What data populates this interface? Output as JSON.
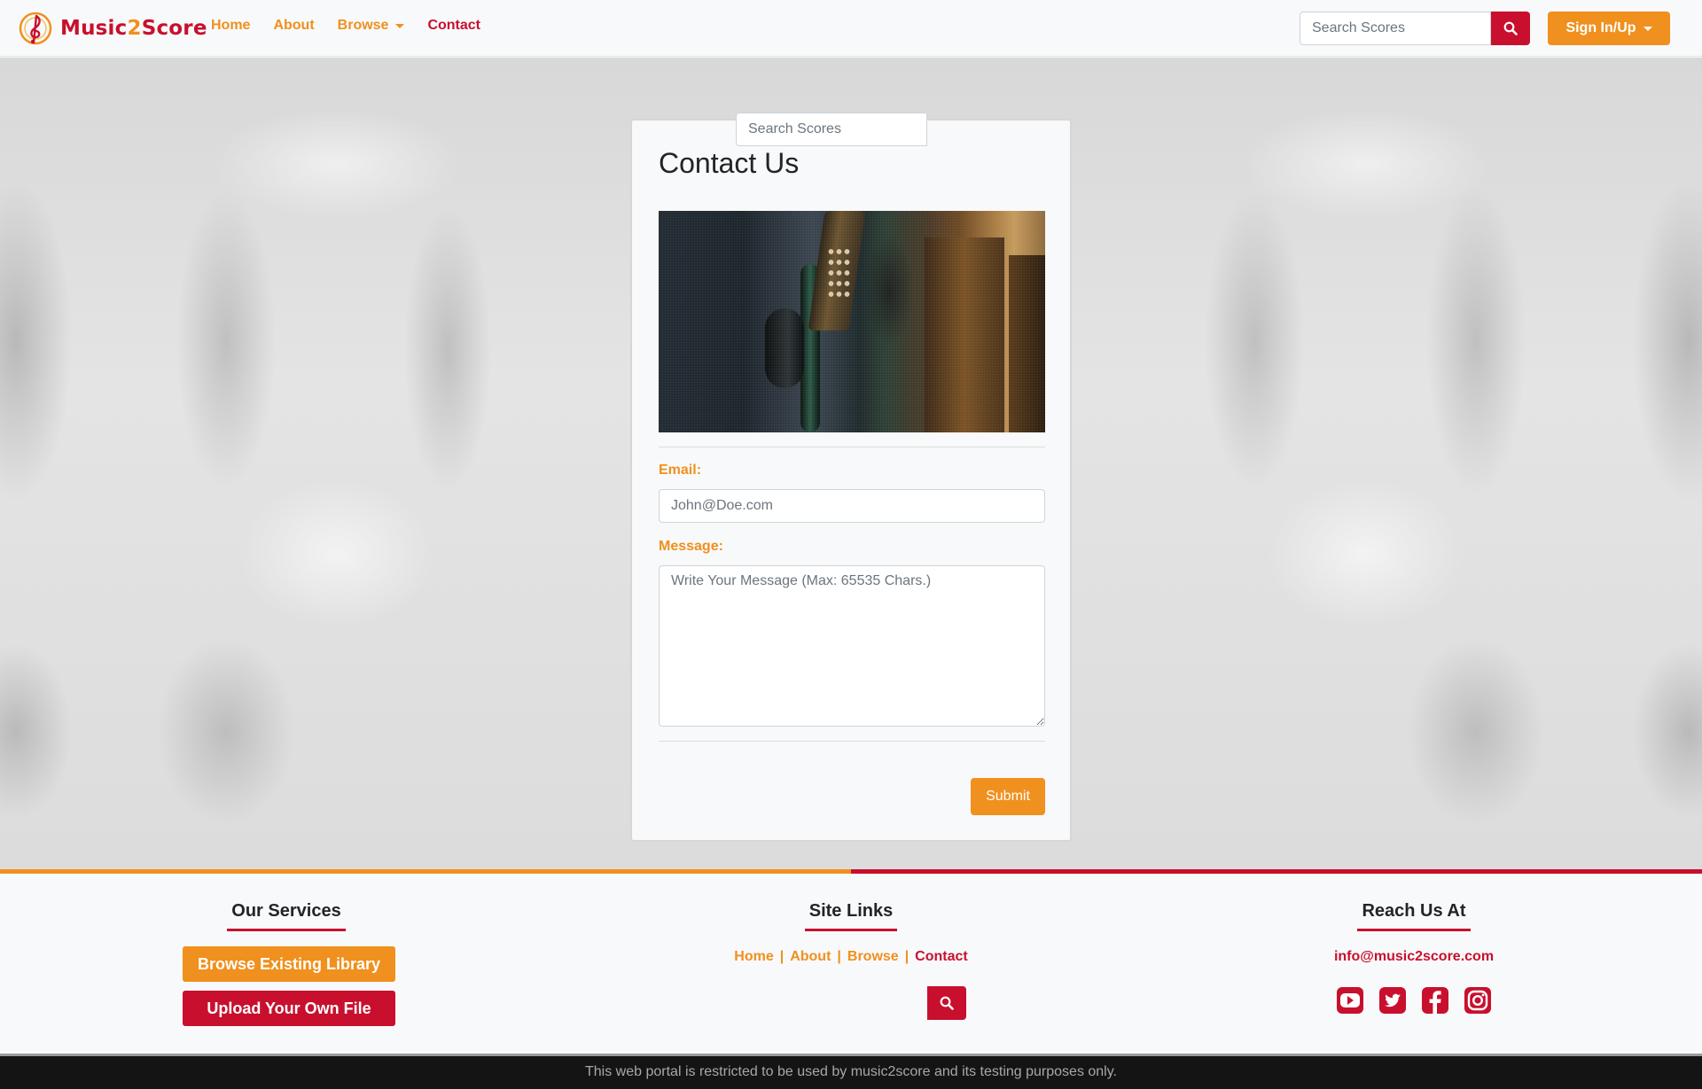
{
  "brand": {
    "name_part1": "Music",
    "name_part2": "2",
    "name_part3": "Score",
    "logo_icon": "music-clef-icon"
  },
  "nav": {
    "items": [
      {
        "label": "Home"
      },
      {
        "label": "About"
      },
      {
        "label": "Browse"
      },
      {
        "label": "Contact"
      }
    ],
    "active": "Contact",
    "search_placeholder": "Search Scores",
    "signin_label": "Sign In/Up"
  },
  "contact": {
    "title": "Contact Us",
    "photo_alt": "payphone-photo",
    "email_label": "Email:",
    "email_placeholder": "John@Doe.com",
    "message_label": "Message:",
    "message_placeholder": "Write Your Message (Max: 65535 Chars.)",
    "submit_label": "Submit"
  },
  "footer": {
    "services": {
      "heading": "Our Services",
      "browse_label": "Browse Existing Library",
      "upload_label": "Upload Your Own File"
    },
    "site_links": {
      "heading": "Site Links",
      "links": [
        {
          "label": "Home"
        },
        {
          "label": "About"
        },
        {
          "label": "Browse"
        },
        {
          "label": "Contact"
        }
      ],
      "separator": "|",
      "search_placeholder": "Search Scores"
    },
    "reach": {
      "heading": "Reach Us At",
      "email": "info@music2score.com",
      "socials": [
        "youtube-icon",
        "twitter-icon",
        "facebook-icon",
        "instagram-icon"
      ]
    },
    "disclaimer": "This web portal is restricted to be used by music2score and its testing purposes only."
  },
  "colors": {
    "accent_orange": "#f0901e",
    "accent_red": "#c8102e"
  }
}
